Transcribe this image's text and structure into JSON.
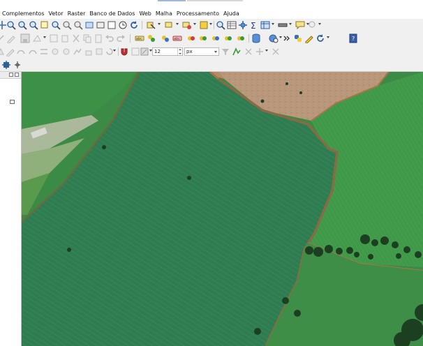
{
  "menubar": {
    "items": [
      "Complementos",
      "Vetor",
      "Raster",
      "Banco de Dados",
      "Web",
      "Malha",
      "Processamento",
      "Ajuda"
    ]
  },
  "toolbar_row3": {
    "font_size_value": "12",
    "unit_value": "px"
  },
  "colors": {
    "crop_field": "#2f7d4f",
    "pasture": "#3e9a48",
    "bare_soil": "#b99a7c",
    "road_dirt": "#a8754c",
    "tree_clump": "#1c3f22"
  },
  "icons": {
    "row1": [
      "pan-map-icon",
      "zoom-in-icon",
      "zoom-out-icon",
      "zoom-full-icon",
      "zoom-selection-icon",
      "zoom-layer-icon",
      "zoom-last-icon",
      "zoom-next-icon",
      "new-bookmark-icon",
      "show-bookmarks-icon",
      "refresh-icon",
      "identify-icon",
      "attribute-table-icon",
      "settings-icon",
      "sum-icon",
      "field-calc-icon",
      "measure-icon",
      "map-tips-icon",
      "text-annotation-icon"
    ],
    "row2": [
      "digitize-icon",
      "edit-pencil-icon",
      "save-edits-icon",
      "add-feature-icon",
      "vertex-tool-icon",
      "delete-icon",
      "cut-icon",
      "copy-icon",
      "paste-icon",
      "undo-icon",
      "redo-icon",
      "label-icon",
      "label-pin-icon",
      "label-show-icon",
      "label-move-icon",
      "label-rotate-icon",
      "label-change-icon",
      "database-icon",
      "globe-icon",
      "python-icon",
      "pencil-gear-icon",
      "plugin-icon",
      "help-icon"
    ],
    "row3": [
      "snap-icon",
      "trace-icon",
      "magnet-icon",
      "snapping-settings-icon",
      "filter-icon",
      "shape-icon",
      "cross-icon",
      "split-icon"
    ],
    "row4": [
      "gps-icon",
      "anchor-icon"
    ]
  }
}
